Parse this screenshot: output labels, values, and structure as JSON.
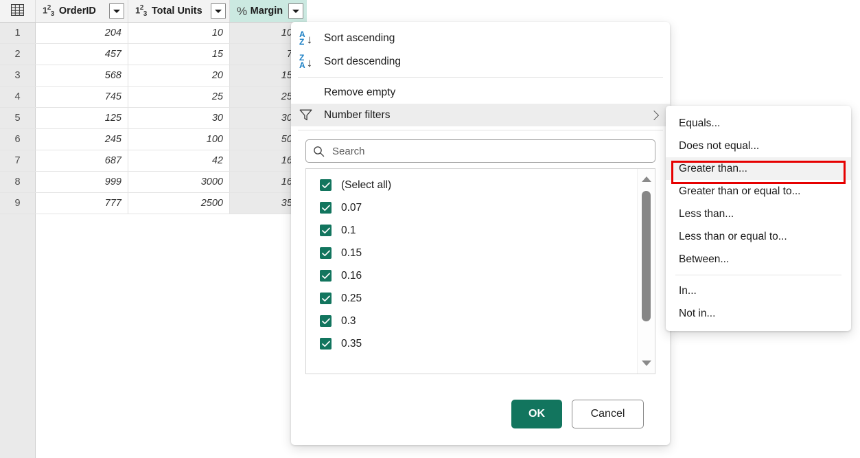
{
  "grid": {
    "corner_icon": "table-icon",
    "columns": [
      {
        "label": "OrderID",
        "type_icon": "123",
        "selected": false
      },
      {
        "label": "Total Units",
        "type_icon": "123",
        "selected": false
      },
      {
        "label": "Margin",
        "type_icon": "%",
        "selected": true
      }
    ],
    "rows": [
      {
        "num": "1",
        "orderid": "204",
        "units": "10",
        "margin": "10.0"
      },
      {
        "num": "2",
        "orderid": "457",
        "units": "15",
        "margin": "7.0"
      },
      {
        "num": "3",
        "orderid": "568",
        "units": "20",
        "margin": "15.0"
      },
      {
        "num": "4",
        "orderid": "745",
        "units": "25",
        "margin": "25.0"
      },
      {
        "num": "5",
        "orderid": "125",
        "units": "30",
        "margin": "30.0"
      },
      {
        "num": "6",
        "orderid": "245",
        "units": "100",
        "margin": "50.0"
      },
      {
        "num": "7",
        "orderid": "687",
        "units": "42",
        "margin": "16.0"
      },
      {
        "num": "8",
        "orderid": "999",
        "units": "3000",
        "margin": "16.0"
      },
      {
        "num": "9",
        "orderid": "777",
        "units": "2500",
        "margin": "35.0"
      }
    ]
  },
  "filter_panel": {
    "sort_ascending": "Sort ascending",
    "sort_descending": "Sort descending",
    "remove_empty": "Remove empty",
    "number_filters": "Number filters",
    "search": {
      "placeholder": "Search",
      "value": ""
    },
    "list_items": [
      {
        "label": "(Select all)",
        "checked": true
      },
      {
        "label": "0.07",
        "checked": true
      },
      {
        "label": "0.1",
        "checked": true
      },
      {
        "label": "0.15",
        "checked": true
      },
      {
        "label": "0.16",
        "checked": true
      },
      {
        "label": "0.25",
        "checked": true
      },
      {
        "label": "0.3",
        "checked": true
      },
      {
        "label": "0.35",
        "checked": true
      }
    ],
    "ok_label": "OK",
    "cancel_label": "Cancel"
  },
  "submenu": {
    "items": [
      {
        "label": "Equals...",
        "highlighted": false
      },
      {
        "label": "Does not equal...",
        "highlighted": false
      },
      {
        "label": "Greater than...",
        "highlighted": true
      },
      {
        "label": "Greater than or equal to...",
        "highlighted": false
      },
      {
        "label": "Less than...",
        "highlighted": false
      },
      {
        "label": "Less than or equal to...",
        "highlighted": false
      },
      {
        "label": "Between...",
        "highlighted": false
      },
      {
        "label": "In...",
        "highlighted": false
      },
      {
        "label": "Not in...",
        "highlighted": false
      }
    ]
  },
  "colors": {
    "accent_green": "#12755e",
    "selected_column_header": "#cbe9e1",
    "selected_column_cells": "#eaeaea",
    "highlight_box": "#e60000",
    "sort_letter_blue": "#1b7fc4"
  }
}
